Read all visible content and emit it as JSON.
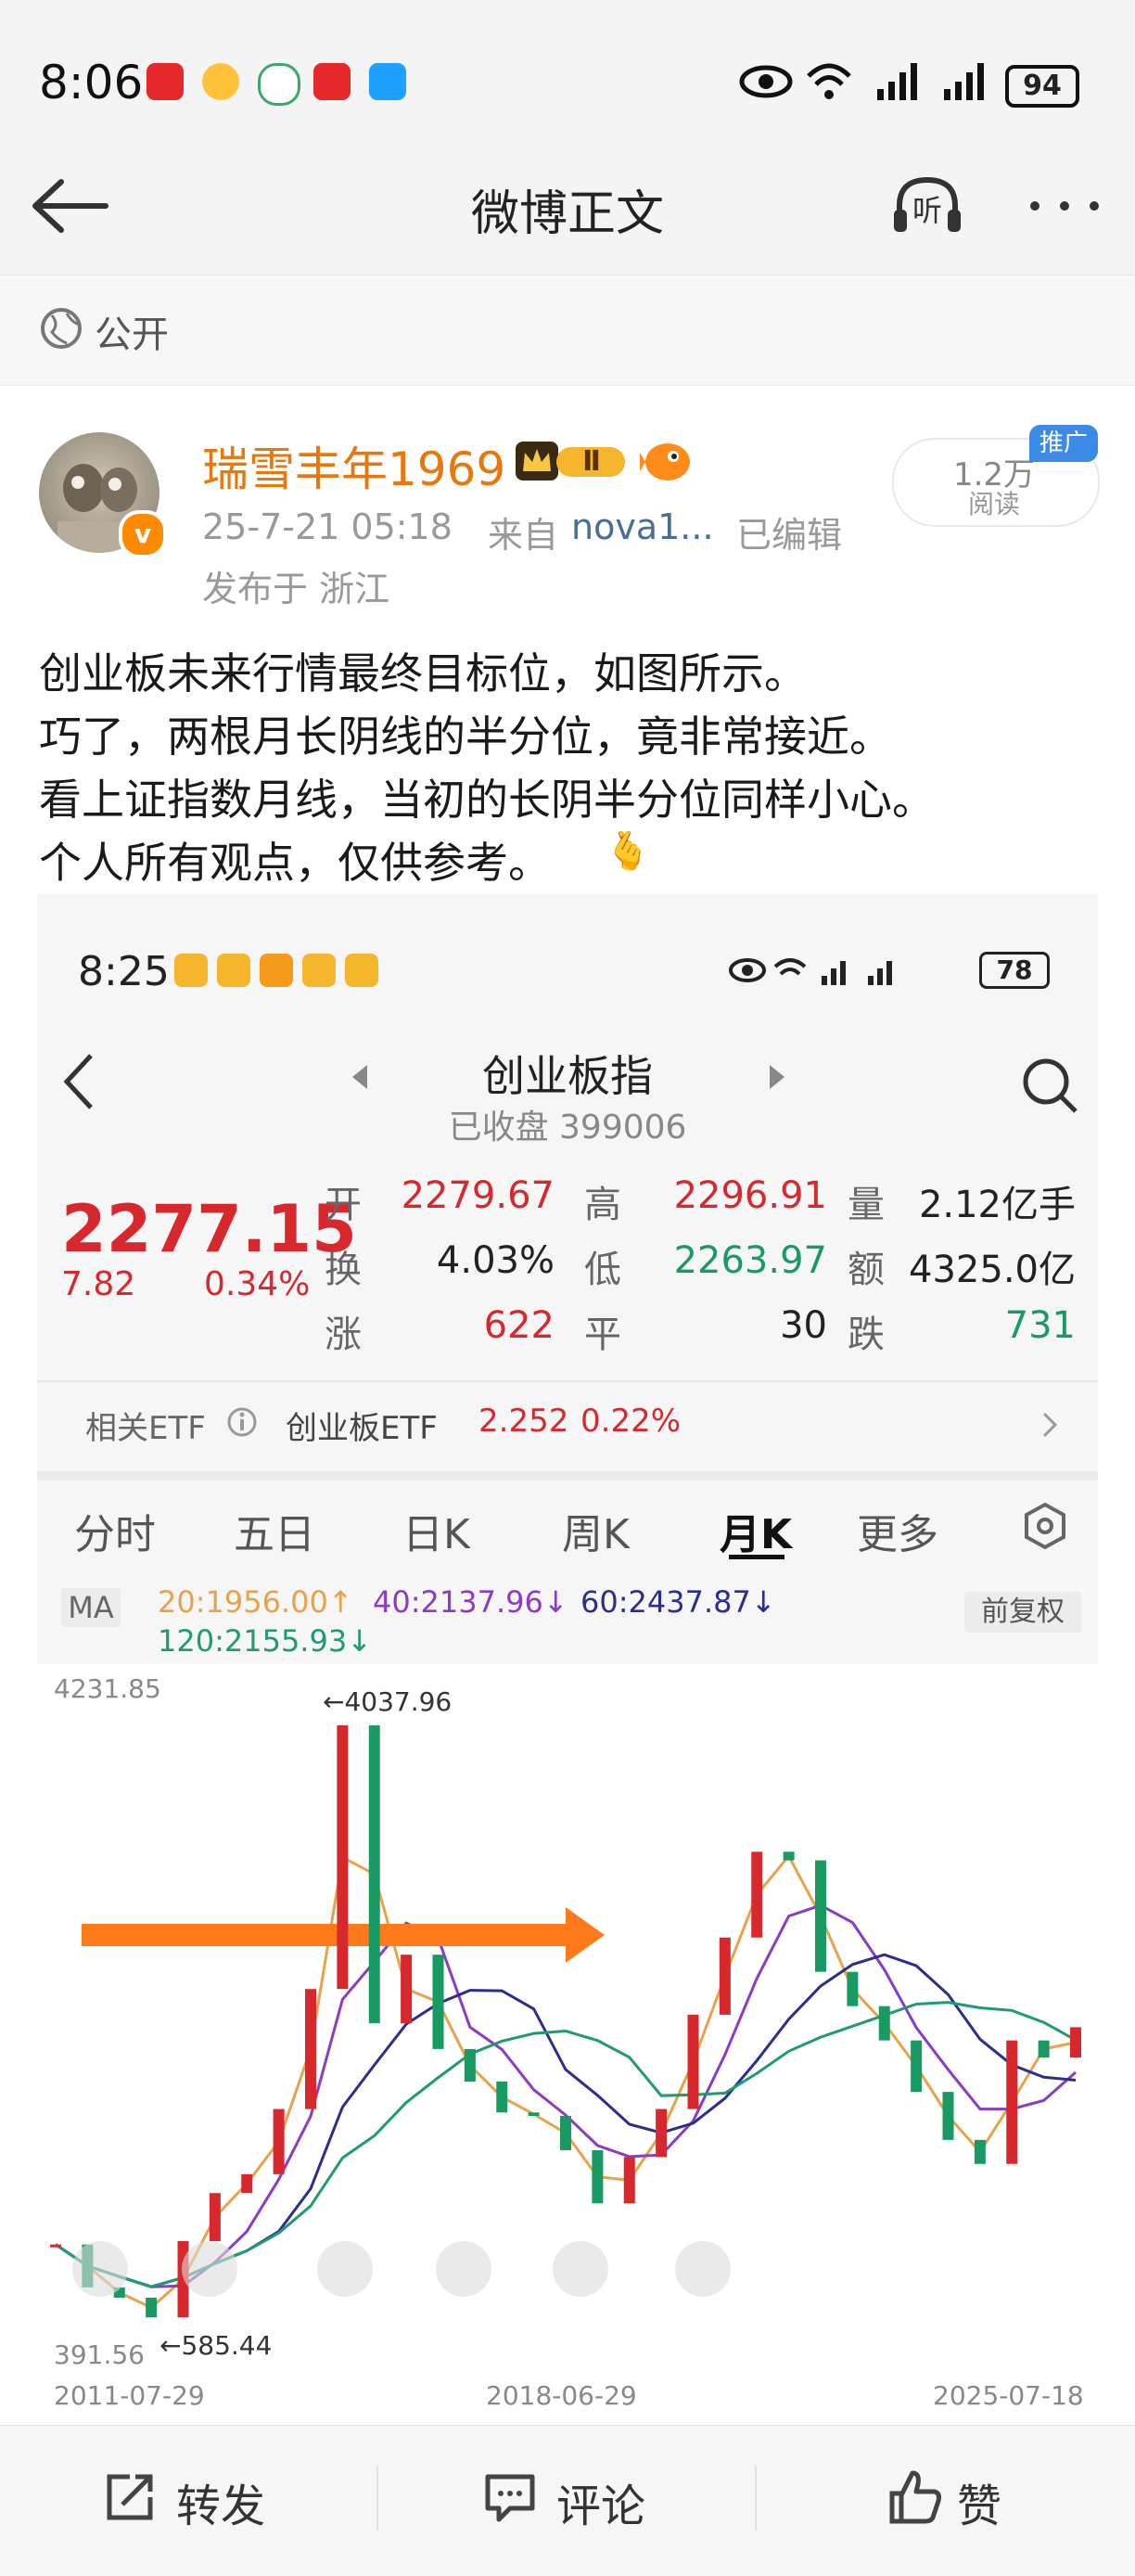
{
  "status_bar": {
    "time": "8:06",
    "battery": "94"
  },
  "nav": {
    "title": "微博正文",
    "listen_label": "听"
  },
  "visibility": {
    "label": "公开"
  },
  "author": {
    "name": "瑞雪丰年1969",
    "vip_level": "Ⅱ",
    "post_time": "25-7-21 05:18",
    "source_prefix": "来自",
    "source": "nova1...",
    "edited": "已编辑",
    "location": "发布于 浙江",
    "read_count": "1.2万",
    "read_label": "阅读",
    "promo_badge": "推广"
  },
  "post": {
    "lines": [
      "创业板未来行情最终目标位，如图所示。",
      "巧了，两根月长阴线的半分位，竟非常接近。",
      "看上证指数月线，当初的长阴半分位同样小心。",
      "个人所有观点，仅供参考。"
    ],
    "emoji": "🫰"
  },
  "embedded": {
    "status_time": "8:25",
    "battery": "78",
    "title": "创业板指",
    "subtitle": "已收盘 399006",
    "price": "2277.15",
    "change": "7.82",
    "change_pct": "0.34%",
    "quote": {
      "open_label": "开",
      "open": "2279.67",
      "high_label": "高",
      "high": "2296.91",
      "vol_label": "量",
      "vol": "2.12亿手",
      "turn_label": "换",
      "turn": "4.03%",
      "low_label": "低",
      "low": "2263.97",
      "amt_label": "额",
      "amt": "4325.0亿",
      "up_label": "涨",
      "up": "622",
      "flat_label": "平",
      "flat": "30",
      "down_label": "跌",
      "down": "731"
    },
    "etf": {
      "prefix": "相关ETF",
      "name": "创业板ETF",
      "price": "2.252",
      "pct": "0.22%"
    },
    "tabs": [
      "分时",
      "五日",
      "日K",
      "周K",
      "月K",
      "更多"
    ],
    "active_tab": "月K",
    "ma_label": "MA",
    "ma": [
      "20:1956.00↑",
      "40:2137.96↓",
      "60:2437.87↓",
      "120:2155.93↓"
    ],
    "adjust": "前复权",
    "colors": {
      "up": "#d7282e",
      "down": "#1a9a63",
      "ma20": "#e8a24a",
      "ma40": "#8b3cc7",
      "ma60": "#2b2f8a",
      "ma120": "#1f9a74",
      "arrow": "#ff7a1a"
    }
  },
  "chart_data": {
    "type": "line",
    "title": "",
    "xlabel": "",
    "ylabel": "",
    "x_ticks": [
      "2011-07-29",
      "2018-06-29",
      "2025-07-18"
    ],
    "y_top_label": "4231.85",
    "y_bottom_label": "391.56",
    "annotations": [
      {
        "text": "←4037.96",
        "x": "2015-06",
        "y": 4037.96
      },
      {
        "text": "←585.44",
        "x": "2012-12",
        "y": 585.44
      }
    ],
    "ylim": [
      391.56,
      4231.85
    ],
    "series": [
      {
        "name": "",
        "x": [
          "2011-07",
          "2012-01",
          "2012-06",
          "2012-12",
          "2013-06",
          "2013-12",
          "2014-06",
          "2014-12",
          "2015-03",
          "2015-06",
          "2015-09",
          "2015-12",
          "2016-06",
          "2016-12",
          "2017-06",
          "2017-12",
          "2018-06",
          "2018-12",
          "2019-06",
          "2019-12",
          "2020-06",
          "2020-12",
          "2021-06",
          "2021-12",
          "2022-06",
          "2022-12",
          "2023-06",
          "2023-12",
          "2024-06",
          "2024-09",
          "2024-12",
          "2025-03",
          "2025-07"
        ],
        "values": [
          1010,
          760,
          700,
          585,
          1030,
          1310,
          1420,
          1800,
          2500,
          4037,
          2300,
          2700,
          2150,
          1960,
          1780,
          1760,
          1560,
          1250,
          1520,
          1800,
          2350,
          2800,
          3300,
          3250,
          2600,
          2400,
          2200,
          1900,
          1620,
          1480,
          2200,
          2100,
          2277
        ]
      }
    ]
  },
  "bottom": {
    "repost": "转发",
    "comment": "评论",
    "like": "赞"
  }
}
